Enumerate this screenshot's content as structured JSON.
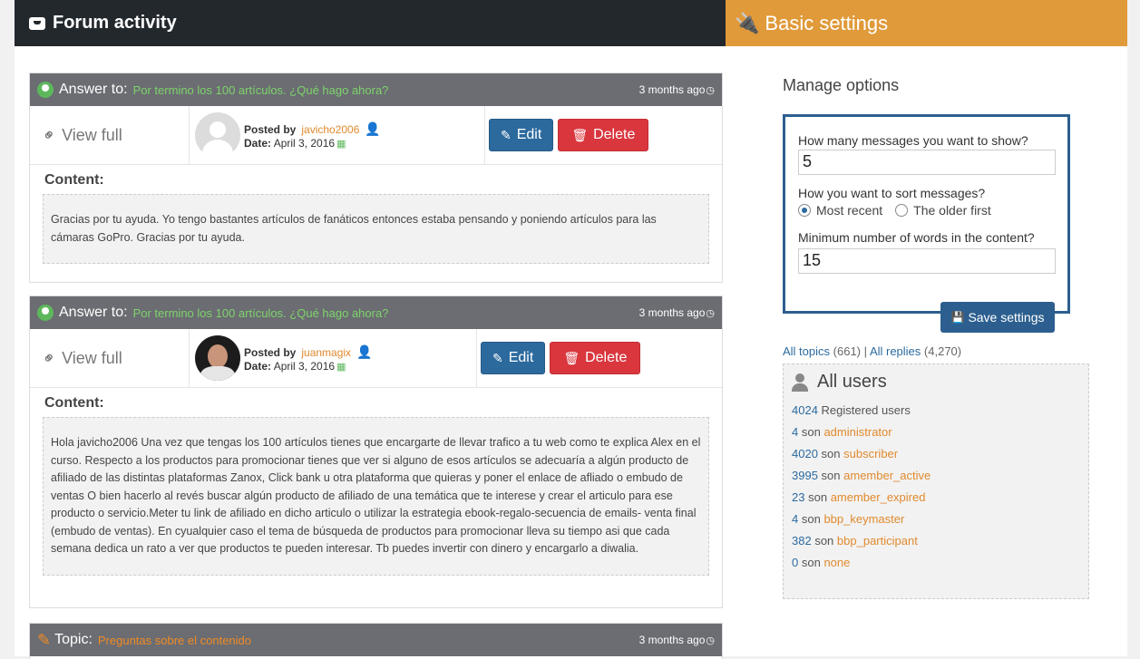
{
  "left_header": {
    "title": "Forum activity"
  },
  "right_header": {
    "title": "Basic settings"
  },
  "cards": [
    {
      "kind": "Answer to:",
      "topic": "Por termino los 100 artículos. ¿Qué hago ahora?",
      "ago": "3 months ago",
      "view_full": "View full",
      "posted_by_label": "Posted by",
      "user": "javicho2006",
      "date_label": "Date:",
      "date": "April 3, 2016",
      "edit": "Edit",
      "delete": "Delete",
      "content_label": "Content:",
      "content": "Gracias por tu ayuda. Yo tengo bastantes artículos de fanáticos entonces estaba pensando y poniendo artículos para las cámaras GoPro. Gracias por tu ayuda."
    },
    {
      "kind": "Answer to:",
      "topic": "Por termino los 100 artículos. ¿Qué hago ahora?",
      "ago": "3 months ago",
      "view_full": "View full",
      "posted_by_label": "Posted by",
      "user": "juanmagix",
      "date_label": "Date:",
      "date": "April 3, 2016",
      "edit": "Edit",
      "delete": "Delete",
      "content_label": "Content:",
      "content": "Hola javicho2006 Una vez que tengas los 100 artículos tienes que encargarte de llevar trafico a tu web como te explica Alex en el curso. Respecto a los productos para promocionar tienes que ver si alguno de esos artículos se adecuaría a algún producto de afiliado de las distintas plataformas Zanox, Click bank u otra plataforma que quieras y poner el enlace de afliado o embudo de ventas O bien hacerlo al revés buscar algún producto de afiliado de una temática que te interese y crear el articulo para ese producto o servicio.Meter tu link de afiliado en dicho articulo o utilizar la estrategia ebook-regalo-secuencia de emails- venta final (embudo de ventas). En cyualquier caso el tema de búsqueda de productos para promocionar lleva su tiempo asi que cada semana dedica un rato a ver que productos te pueden interesar. Tb puedes invertir con dinero y encargarlo a diwalia."
    },
    {
      "kind": "Topic:",
      "topic": "Preguntas sobre el contenido",
      "ago": "3 months ago"
    }
  ],
  "settings": {
    "manage_title": "Manage options",
    "q_messages": "How many messages you want to show?",
    "messages_value": "5",
    "q_sort": "How you want to sort messages?",
    "opt_recent": "Most recent",
    "opt_older": "The older first",
    "q_words": "Minimum number of words in the content?",
    "words_value": "15",
    "save": "Save settings"
  },
  "counts": {
    "topics_label": "All topics",
    "topics": "(661)",
    "sep": "|",
    "replies_label": "All replies",
    "replies": "(4,270)"
  },
  "all_users": {
    "title": "All users",
    "registered_n": "4024",
    "registered_label": "Registered users",
    "son": "son",
    "roles": [
      {
        "n": "4",
        "role": "administrator"
      },
      {
        "n": "4020",
        "role": "subscriber"
      },
      {
        "n": "3995",
        "role": "amember_active"
      },
      {
        "n": "23",
        "role": "amember_expired"
      },
      {
        "n": "4",
        "role": "bbp_keymaster"
      },
      {
        "n": "382",
        "role": "bbp_participant"
      },
      {
        "n": "0",
        "role": "none"
      }
    ]
  }
}
